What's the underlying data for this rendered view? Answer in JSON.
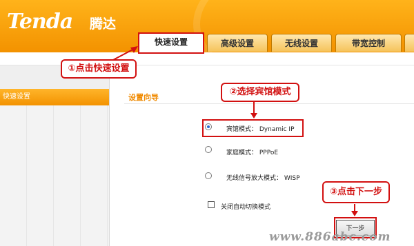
{
  "brand": {
    "logo": "Tenda",
    "name_cn": "腾达"
  },
  "tabs": [
    {
      "label": "快速设置"
    },
    {
      "label": "高级设置"
    },
    {
      "label": "无线设置"
    },
    {
      "label": "带宽控制"
    }
  ],
  "sidebar": {
    "items": [
      {
        "label": "快速设置"
      }
    ]
  },
  "main": {
    "title": "设置向导",
    "options": [
      {
        "label": "宾馆模式： Dynamic IP",
        "selected": true
      },
      {
        "label": "家庭模式： PPPoE",
        "selected": false
      },
      {
        "label": "无线信号放大模式： WISP",
        "selected": false
      }
    ],
    "auto_switch": {
      "label": "关闭自动切换模式",
      "checked": false
    },
    "next_button": "下一步"
  },
  "annotations": {
    "step1": "①点击快速设置",
    "step2": "②选择宾馆模式",
    "step3": "③点击下一步"
  },
  "watermark": "www.886abc.com",
  "colors": {
    "accent": "#f39200",
    "annotation_red": "#d21010",
    "title_orange": "#f08a00"
  }
}
